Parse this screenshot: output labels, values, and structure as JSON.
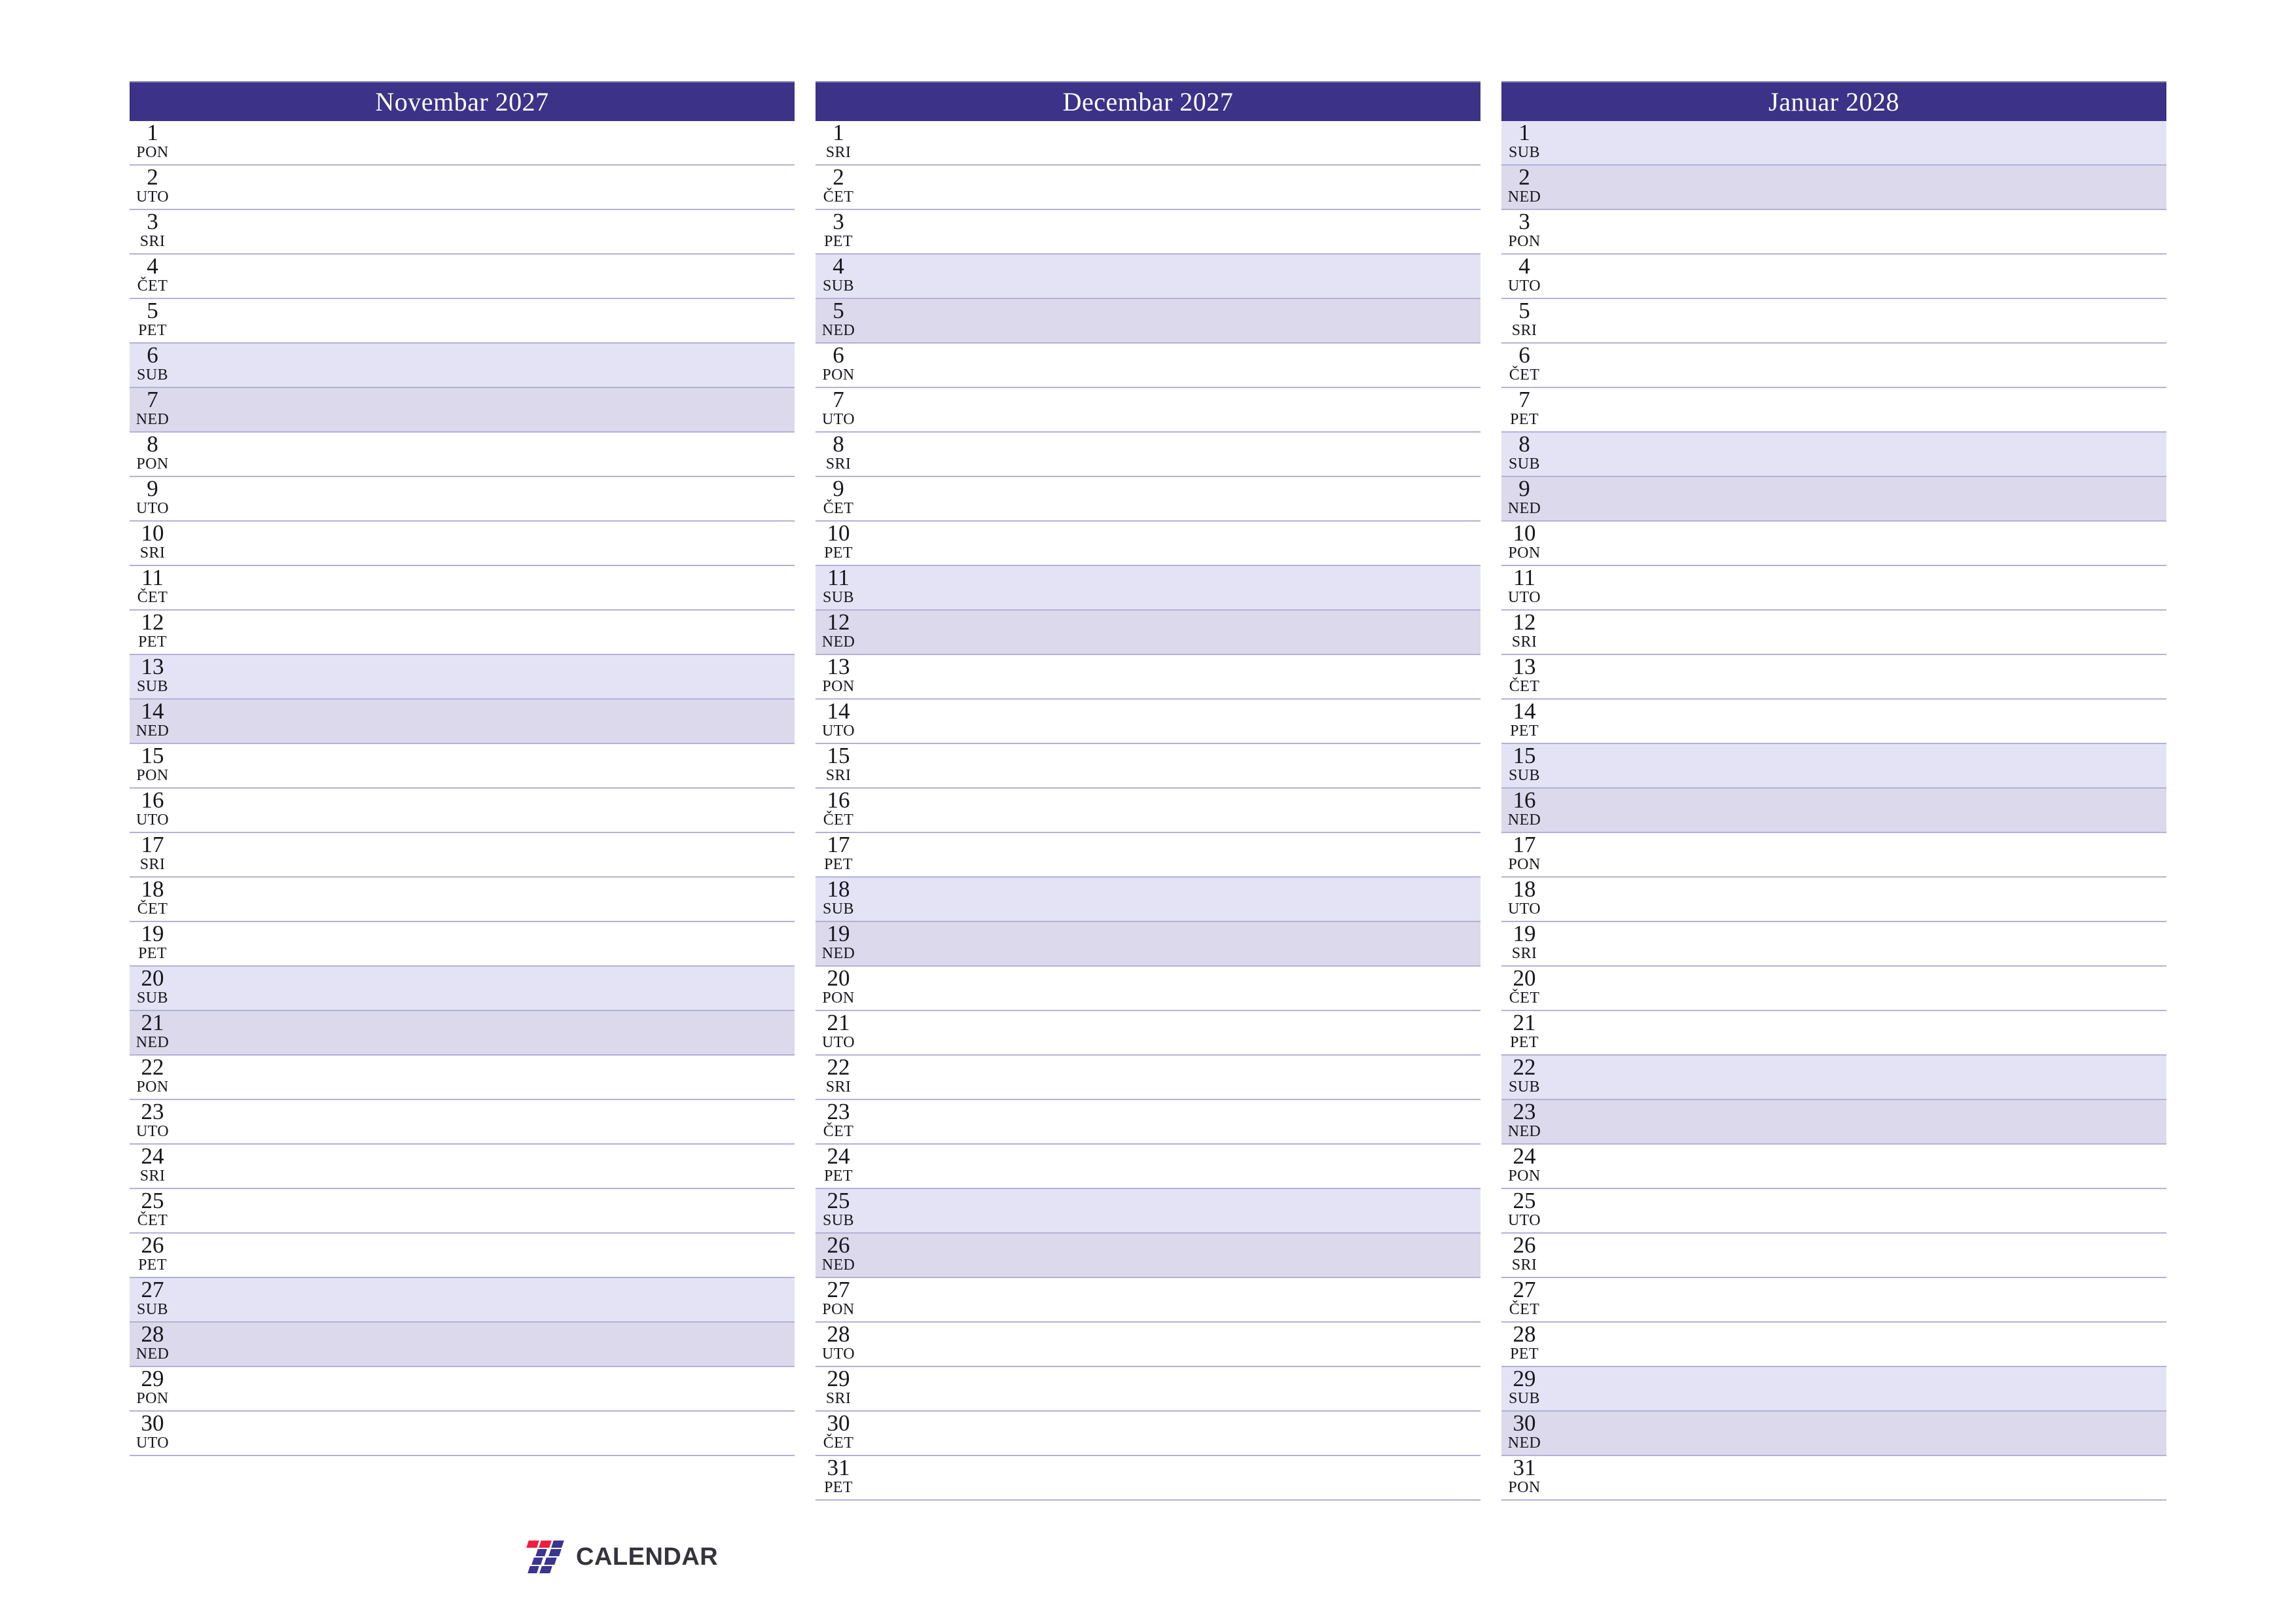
{
  "page": {
    "type": "printable-monthly-planner",
    "locale": "bs",
    "accent_color": "#3c3287",
    "weekend_saturday_color": "#e3e3f5",
    "weekend_sunday_color": "#dcd9ec",
    "row_separator_color": "#b4b1d4"
  },
  "brand": {
    "name": "CALENDAR",
    "mark": "seven-logo-icon",
    "mark_colors": [
      "#ef1d3e",
      "#3b3490"
    ],
    "text_color": "#35343c"
  },
  "months": [
    {
      "title": "Novembar 2027",
      "month": "Novembar",
      "year": "2027",
      "days": [
        {
          "num": "1",
          "dow": "PON",
          "kind": "weekday"
        },
        {
          "num": "2",
          "dow": "UTO",
          "kind": "weekday"
        },
        {
          "num": "3",
          "dow": "SRI",
          "kind": "weekday"
        },
        {
          "num": "4",
          "dow": "ČET",
          "kind": "weekday"
        },
        {
          "num": "5",
          "dow": "PET",
          "kind": "weekday"
        },
        {
          "num": "6",
          "dow": "SUB",
          "kind": "saturday"
        },
        {
          "num": "7",
          "dow": "NED",
          "kind": "sunday"
        },
        {
          "num": "8",
          "dow": "PON",
          "kind": "weekday"
        },
        {
          "num": "9",
          "dow": "UTO",
          "kind": "weekday"
        },
        {
          "num": "10",
          "dow": "SRI",
          "kind": "weekday"
        },
        {
          "num": "11",
          "dow": "ČET",
          "kind": "weekday"
        },
        {
          "num": "12",
          "dow": "PET",
          "kind": "weekday"
        },
        {
          "num": "13",
          "dow": "SUB",
          "kind": "saturday"
        },
        {
          "num": "14",
          "dow": "NED",
          "kind": "sunday"
        },
        {
          "num": "15",
          "dow": "PON",
          "kind": "weekday"
        },
        {
          "num": "16",
          "dow": "UTO",
          "kind": "weekday"
        },
        {
          "num": "17",
          "dow": "SRI",
          "kind": "weekday"
        },
        {
          "num": "18",
          "dow": "ČET",
          "kind": "weekday"
        },
        {
          "num": "19",
          "dow": "PET",
          "kind": "weekday"
        },
        {
          "num": "20",
          "dow": "SUB",
          "kind": "saturday"
        },
        {
          "num": "21",
          "dow": "NED",
          "kind": "sunday"
        },
        {
          "num": "22",
          "dow": "PON",
          "kind": "weekday"
        },
        {
          "num": "23",
          "dow": "UTO",
          "kind": "weekday"
        },
        {
          "num": "24",
          "dow": "SRI",
          "kind": "weekday"
        },
        {
          "num": "25",
          "dow": "ČET",
          "kind": "weekday"
        },
        {
          "num": "26",
          "dow": "PET",
          "kind": "weekday"
        },
        {
          "num": "27",
          "dow": "SUB",
          "kind": "saturday"
        },
        {
          "num": "28",
          "dow": "NED",
          "kind": "sunday"
        },
        {
          "num": "29",
          "dow": "PON",
          "kind": "weekday"
        },
        {
          "num": "30",
          "dow": "UTO",
          "kind": "weekday"
        }
      ]
    },
    {
      "title": "Decembar 2027",
      "month": "Decembar",
      "year": "2027",
      "days": [
        {
          "num": "1",
          "dow": "SRI",
          "kind": "weekday"
        },
        {
          "num": "2",
          "dow": "ČET",
          "kind": "weekday"
        },
        {
          "num": "3",
          "dow": "PET",
          "kind": "weekday"
        },
        {
          "num": "4",
          "dow": "SUB",
          "kind": "saturday"
        },
        {
          "num": "5",
          "dow": "NED",
          "kind": "sunday"
        },
        {
          "num": "6",
          "dow": "PON",
          "kind": "weekday"
        },
        {
          "num": "7",
          "dow": "UTO",
          "kind": "weekday"
        },
        {
          "num": "8",
          "dow": "SRI",
          "kind": "weekday"
        },
        {
          "num": "9",
          "dow": "ČET",
          "kind": "weekday"
        },
        {
          "num": "10",
          "dow": "PET",
          "kind": "weekday"
        },
        {
          "num": "11",
          "dow": "SUB",
          "kind": "saturday"
        },
        {
          "num": "12",
          "dow": "NED",
          "kind": "sunday"
        },
        {
          "num": "13",
          "dow": "PON",
          "kind": "weekday"
        },
        {
          "num": "14",
          "dow": "UTO",
          "kind": "weekday"
        },
        {
          "num": "15",
          "dow": "SRI",
          "kind": "weekday"
        },
        {
          "num": "16",
          "dow": "ČET",
          "kind": "weekday"
        },
        {
          "num": "17",
          "dow": "PET",
          "kind": "weekday"
        },
        {
          "num": "18",
          "dow": "SUB",
          "kind": "saturday"
        },
        {
          "num": "19",
          "dow": "NED",
          "kind": "sunday"
        },
        {
          "num": "20",
          "dow": "PON",
          "kind": "weekday"
        },
        {
          "num": "21",
          "dow": "UTO",
          "kind": "weekday"
        },
        {
          "num": "22",
          "dow": "SRI",
          "kind": "weekday"
        },
        {
          "num": "23",
          "dow": "ČET",
          "kind": "weekday"
        },
        {
          "num": "24",
          "dow": "PET",
          "kind": "weekday"
        },
        {
          "num": "25",
          "dow": "SUB",
          "kind": "saturday"
        },
        {
          "num": "26",
          "dow": "NED",
          "kind": "sunday"
        },
        {
          "num": "27",
          "dow": "PON",
          "kind": "weekday"
        },
        {
          "num": "28",
          "dow": "UTO",
          "kind": "weekday"
        },
        {
          "num": "29",
          "dow": "SRI",
          "kind": "weekday"
        },
        {
          "num": "30",
          "dow": "ČET",
          "kind": "weekday"
        },
        {
          "num": "31",
          "dow": "PET",
          "kind": "weekday"
        }
      ]
    },
    {
      "title": "Januar 2028",
      "month": "Januar",
      "year": "2028",
      "days": [
        {
          "num": "1",
          "dow": "SUB",
          "kind": "saturday"
        },
        {
          "num": "2",
          "dow": "NED",
          "kind": "sunday"
        },
        {
          "num": "3",
          "dow": "PON",
          "kind": "weekday"
        },
        {
          "num": "4",
          "dow": "UTO",
          "kind": "weekday"
        },
        {
          "num": "5",
          "dow": "SRI",
          "kind": "weekday"
        },
        {
          "num": "6",
          "dow": "ČET",
          "kind": "weekday"
        },
        {
          "num": "7",
          "dow": "PET",
          "kind": "weekday"
        },
        {
          "num": "8",
          "dow": "SUB",
          "kind": "saturday"
        },
        {
          "num": "9",
          "dow": "NED",
          "kind": "sunday"
        },
        {
          "num": "10",
          "dow": "PON",
          "kind": "weekday"
        },
        {
          "num": "11",
          "dow": "UTO",
          "kind": "weekday"
        },
        {
          "num": "12",
          "dow": "SRI",
          "kind": "weekday"
        },
        {
          "num": "13",
          "dow": "ČET",
          "kind": "weekday"
        },
        {
          "num": "14",
          "dow": "PET",
          "kind": "weekday"
        },
        {
          "num": "15",
          "dow": "SUB",
          "kind": "saturday"
        },
        {
          "num": "16",
          "dow": "NED",
          "kind": "sunday"
        },
        {
          "num": "17",
          "dow": "PON",
          "kind": "weekday"
        },
        {
          "num": "18",
          "dow": "UTO",
          "kind": "weekday"
        },
        {
          "num": "19",
          "dow": "SRI",
          "kind": "weekday"
        },
        {
          "num": "20",
          "dow": "ČET",
          "kind": "weekday"
        },
        {
          "num": "21",
          "dow": "PET",
          "kind": "weekday"
        },
        {
          "num": "22",
          "dow": "SUB",
          "kind": "saturday"
        },
        {
          "num": "23",
          "dow": "NED",
          "kind": "sunday"
        },
        {
          "num": "24",
          "dow": "PON",
          "kind": "weekday"
        },
        {
          "num": "25",
          "dow": "UTO",
          "kind": "weekday"
        },
        {
          "num": "26",
          "dow": "SRI",
          "kind": "weekday"
        },
        {
          "num": "27",
          "dow": "ČET",
          "kind": "weekday"
        },
        {
          "num": "28",
          "dow": "PET",
          "kind": "weekday"
        },
        {
          "num": "29",
          "dow": "SUB",
          "kind": "saturday"
        },
        {
          "num": "30",
          "dow": "NED",
          "kind": "sunday"
        },
        {
          "num": "31",
          "dow": "PON",
          "kind": "weekday"
        }
      ]
    }
  ]
}
